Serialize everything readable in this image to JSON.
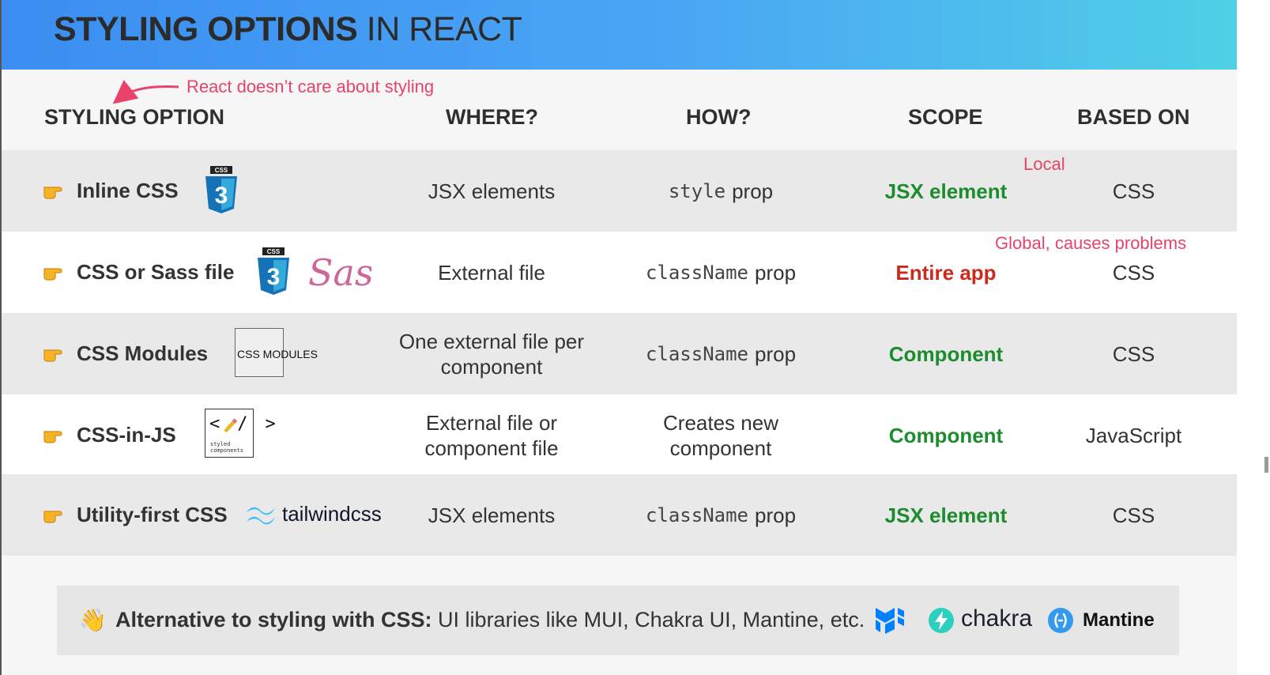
{
  "title": {
    "bold": "STYLING OPTIONS",
    "rest": " IN REACT"
  },
  "notes": {
    "react": "React doesn’t care about styling",
    "local": "Local",
    "global": "Global, causes problems"
  },
  "columns": {
    "option": "STYLING OPTION",
    "where": "WHERE?",
    "how": "HOW?",
    "scope": "SCOPE",
    "based": "BASED ON"
  },
  "rows": [
    {
      "name": "Inline CSS",
      "where": "JSX elements",
      "how_code": "style",
      "how_text": "prop",
      "scope": "JSX element",
      "based": "CSS"
    },
    {
      "name": "CSS or Sass file",
      "where": "External file",
      "how_code": "className",
      "how_text": "prop",
      "scope": "Entire app",
      "based": "CSS"
    },
    {
      "name": "CSS Modules",
      "where": "One external file per component",
      "how_code": "className",
      "how_text": "prop",
      "scope": "Component",
      "based": "CSS"
    },
    {
      "name": "CSS-in-JS",
      "where": "External file or component file",
      "how_text": "Creates new component",
      "scope": "Component",
      "based": "JavaScript"
    },
    {
      "name": "Utility-first CSS",
      "where": "JSX elements",
      "how_code": "className",
      "how_text": "prop",
      "scope": "JSX element",
      "based": "CSS"
    }
  ],
  "logos": {
    "css3_badge": "CSS",
    "css3_number": "3",
    "sass": "Sass",
    "css_modules": "CSS MODULES",
    "styled_brackets": "</>",
    "styled_text": "styled components",
    "tailwind": "tailwindcss",
    "chakra": "chakra",
    "mantine": "Mantine"
  },
  "footer": {
    "emoji": "👋",
    "bold": "Alternative to styling with CSS:",
    "rest": " UI libraries like MUI, Chakra UI, Mantine, etc."
  },
  "colors": {
    "accent": "#e8436a",
    "green": "#1c8c2f",
    "red": "#cc2a1c",
    "header_start": "#3b8ef2",
    "header_end": "#4fd0e6"
  },
  "icons": [
    "pointing-hand-icon",
    "css3-logo",
    "sass-logo",
    "css-modules-logo",
    "styled-components-logo",
    "tailwind-logo",
    "mui-logo",
    "chakra-logo",
    "mantine-logo",
    "waving-hand-icon"
  ]
}
